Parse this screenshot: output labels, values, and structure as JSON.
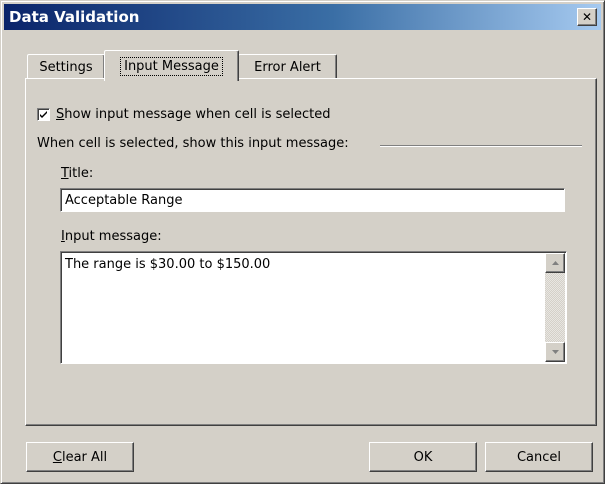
{
  "window": {
    "title": "Data Validation",
    "close_label": "✕"
  },
  "tabs": [
    {
      "label": "Settings",
      "active": false
    },
    {
      "label": "Input Message",
      "active": true
    },
    {
      "label": "Error Alert",
      "active": false
    }
  ],
  "show_message": {
    "checked": true,
    "label_key": "S",
    "label_rest": "how input message when cell is selected"
  },
  "group_label": "When cell is selected, show this input message:",
  "title_field": {
    "label_key": "T",
    "label_rest": "itle:",
    "value": "Acceptable Range"
  },
  "message_field": {
    "label_key": "I",
    "label_rest": "nput message:",
    "value": "The range is $30.00 to $150.00"
  },
  "buttons": {
    "clear_all_key": "C",
    "clear_all_rest": "lear All",
    "ok": "OK",
    "cancel": "Cancel"
  },
  "icons": {
    "close": "close-icon",
    "check": "checkmark-icon",
    "scroll_up": "scroll-up-arrow-icon",
    "scroll_down": "scroll-down-arrow-icon"
  }
}
